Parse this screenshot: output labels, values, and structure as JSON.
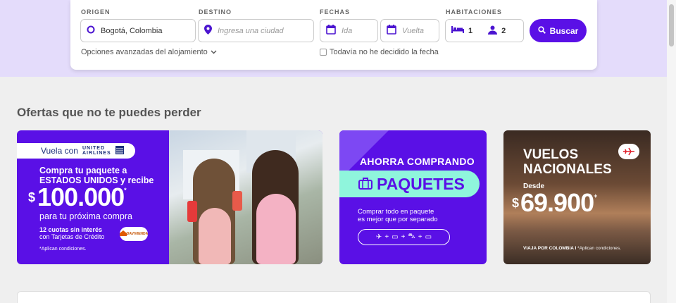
{
  "search": {
    "origin_label": "ORIGEN",
    "origin_value": "Bogotá, Colombia",
    "destination_label": "DESTINO",
    "destination_placeholder": "Ingresa una ciudad",
    "dates_label": "FECHAS",
    "departure_placeholder": "Ida",
    "return_placeholder": "Vuelta",
    "rooms_label": "HABITACIONES",
    "rooms_count": "1",
    "guests_count": "2",
    "search_button": "Buscar",
    "advanced_options": "Opciones avanzadas del alojamiento",
    "undecided_dates": "Todavía no he decidido la fecha"
  },
  "offers": {
    "title": "Ofertas que no te puedes perder",
    "united": {
      "badge_text": "Vuela con",
      "airline_line1": "UNITED",
      "airline_line2": "AIRLINES",
      "headline_line1": "Compra tu paquete a",
      "headline_line2": "ESTADOS UNIDOS y recibe",
      "currency": "$",
      "amount": "100.000",
      "asterisk": "*",
      "next_purchase": "para tu próxima compra",
      "installments_bold": "12 cuotas sin interés",
      "installments_rest": "con Tarjetas de Crédito",
      "bank_badge": "DAVIVIENDA",
      "conditions": "*Aplican condiciones."
    },
    "packages": {
      "save_text": "AHORRA COMPRANDO",
      "packages_text": "PAQUETES",
      "sub_line1": "Comprar todo en paquete",
      "sub_line2": "es mejor que por separado",
      "icons": [
        "✈",
        "+",
        "▭",
        "+",
        "⛍",
        "+",
        "▭"
      ]
    },
    "national": {
      "title_line1": "VUELOS",
      "title_line2": "NACIONALES",
      "desde": "Desde",
      "currency": "$",
      "price": "69.900",
      "asterisk": "+",
      "footer_bold": "VIAJA POR COLOMBIA I",
      "footer_rest": "*Aplican condiciones."
    }
  },
  "colors": {
    "accent": "#5a10e6",
    "mint": "#8ff5dc",
    "band": "#e4dcfb"
  }
}
